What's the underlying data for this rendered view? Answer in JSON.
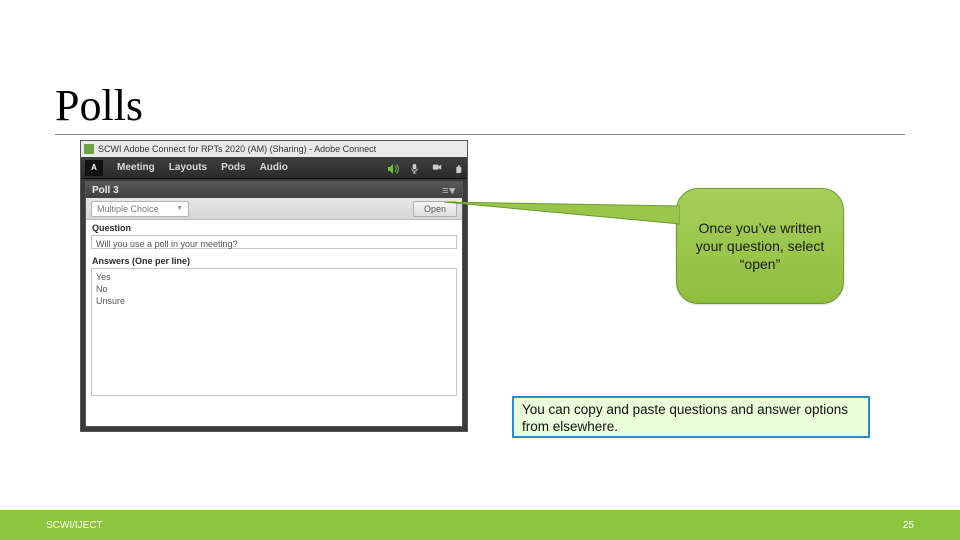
{
  "title": "Polls",
  "window": {
    "title": "SCWI Adobe Connect for RPTs 2020 (AM) (Sharing) - Adobe Connect",
    "logo_text": "A",
    "menu": [
      "Meeting",
      "Layouts",
      "Pods",
      "Audio"
    ]
  },
  "poll": {
    "header": "Poll 3",
    "type_selector": "Multiple Choice",
    "open_button": "Open",
    "question_label": "Question",
    "question_value": "Will you use a poll in your meeting?",
    "answers_label": "Answers (One per line)",
    "answers_value": "Yes\nNo\nUnsure"
  },
  "callout": "Once you’ve written your question, select “open”",
  "note": "You can copy and paste questions and answer options from elsewhere.",
  "footer": {
    "left": "SCWI/IJECT",
    "page": "25"
  }
}
